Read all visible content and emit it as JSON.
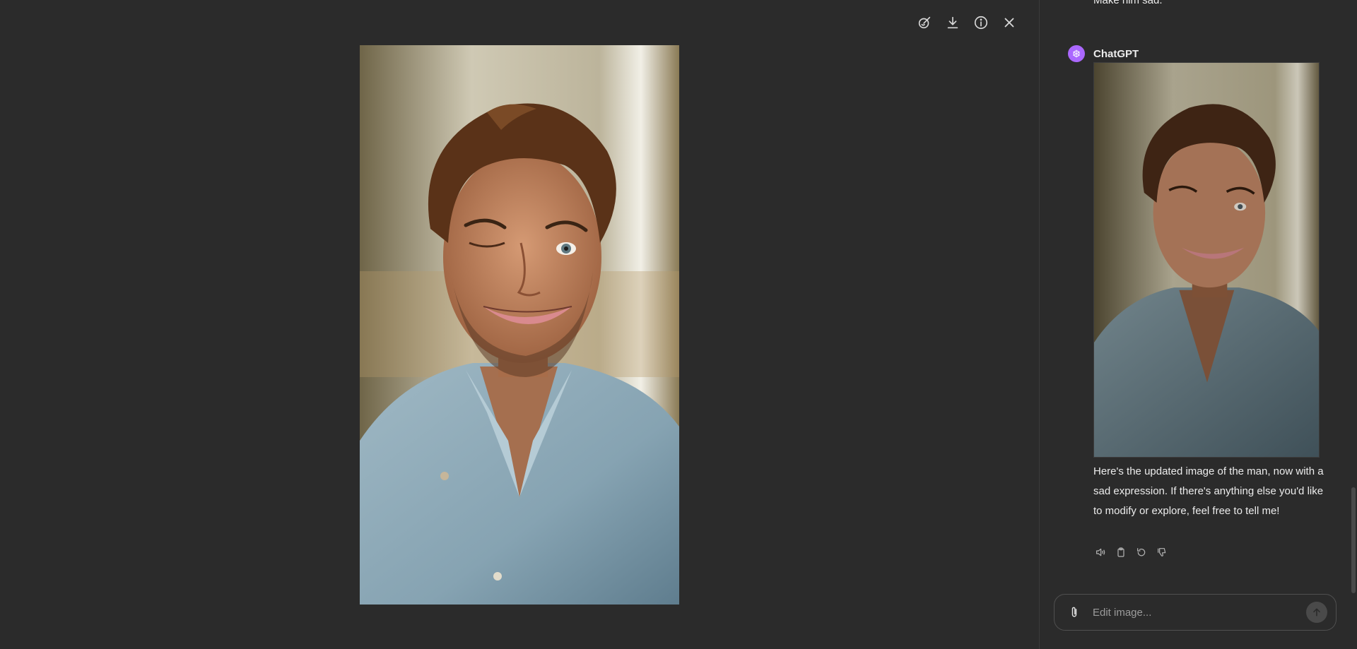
{
  "viewer": {
    "toolbar": [
      {
        "name": "edit-image-button",
        "icon": "brush-edit-icon"
      },
      {
        "name": "download-button",
        "icon": "download-icon"
      },
      {
        "name": "info-button",
        "icon": "info-icon"
      },
      {
        "name": "close-button",
        "icon": "close-icon"
      }
    ],
    "image": {
      "subject": "smiling-winking-man-portrait"
    }
  },
  "chat": {
    "previous_message": "Make him sad.",
    "author": "ChatGPT",
    "avatar_icon": "openai-logo-icon",
    "avatar_color": "#ab68ff",
    "reply": "Here's the updated image of the man, now with a sad expression. If there's anything else you'd like to modify or explore, feel free to tell me!",
    "actions": [
      "read-aloud-icon",
      "copy-icon",
      "regenerate-icon",
      "thumbs-down-icon"
    ]
  },
  "composer": {
    "placeholder": "Edit image...",
    "attach_icon": "paperclip-icon",
    "send_icon": "arrow-up-icon"
  }
}
